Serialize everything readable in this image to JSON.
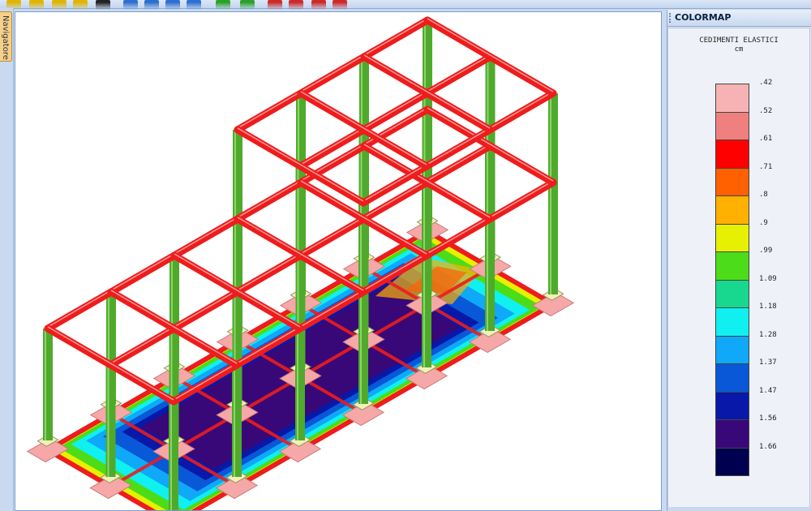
{
  "sidebar": {
    "navigator_label": "Navigatore"
  },
  "toolbar": {
    "buttons": [
      {
        "icon": "zoom-in-icon",
        "color": "#e0b400"
      },
      {
        "icon": "zoom-window-icon",
        "color": "#e0b400"
      },
      {
        "icon": "zoom-out-icon",
        "color": "#e0b400"
      },
      {
        "icon": "print-icon",
        "color": "#e0b400"
      },
      {
        "icon": "camera-icon",
        "color": "#222222"
      },
      {
        "icon": "view-front-icon",
        "color": "#2d6fd0"
      },
      {
        "icon": "view-side-icon",
        "color": "#2d6fd0"
      },
      {
        "icon": "view-iso-icon",
        "color": "#2d6fd0"
      },
      {
        "icon": "view-top-icon",
        "color": "#2d6fd0"
      },
      {
        "icon": "dimensions-icon",
        "color": "#2aa02a"
      },
      {
        "icon": "loads-icon",
        "color": "#2aa02a"
      },
      {
        "icon": "export-pdf-icon",
        "color": "#cc2a2a"
      },
      {
        "icon": "previous-icon",
        "color": "#cc2a2a"
      },
      {
        "icon": "report-icon",
        "color": "#cc2a2a"
      },
      {
        "icon": "next-icon",
        "color": "#cc2a2a"
      }
    ]
  },
  "colormap": {
    "header": "COLORMAP",
    "title": "CEDIMENTI ELASTICI",
    "unit": "cm",
    "entries": [
      {
        "label": ".42",
        "color": "#f7b3b3"
      },
      {
        "label": ".52",
        "color": "#f08080"
      },
      {
        "label": ".61",
        "color": "#ff0000"
      },
      {
        "label": ".71",
        "color": "#ff6000"
      },
      {
        "label": ".8",
        "color": "#ffb000"
      },
      {
        "label": ".9",
        "color": "#e6f000"
      },
      {
        "label": ".99",
        "color": "#4ddc18"
      },
      {
        "label": "1.09",
        "color": "#18d890"
      },
      {
        "label": "1.18",
        "color": "#10f0f0"
      },
      {
        "label": "1.28",
        "color": "#10a8f8"
      },
      {
        "label": "1.37",
        "color": "#0858d8"
      },
      {
        "label": "1.47",
        "color": "#0818a8"
      },
      {
        "label": "1.56",
        "color": "#380878"
      },
      {
        "label": "1.66",
        "color": "#000050"
      }
    ]
  },
  "model_colors": {
    "beam": "#ee1c1c",
    "column": "#4faa2c",
    "plinth": "#f6a8a8",
    "pedestal": "#f2f0b8",
    "slab_edge": "#ee1c1c"
  }
}
